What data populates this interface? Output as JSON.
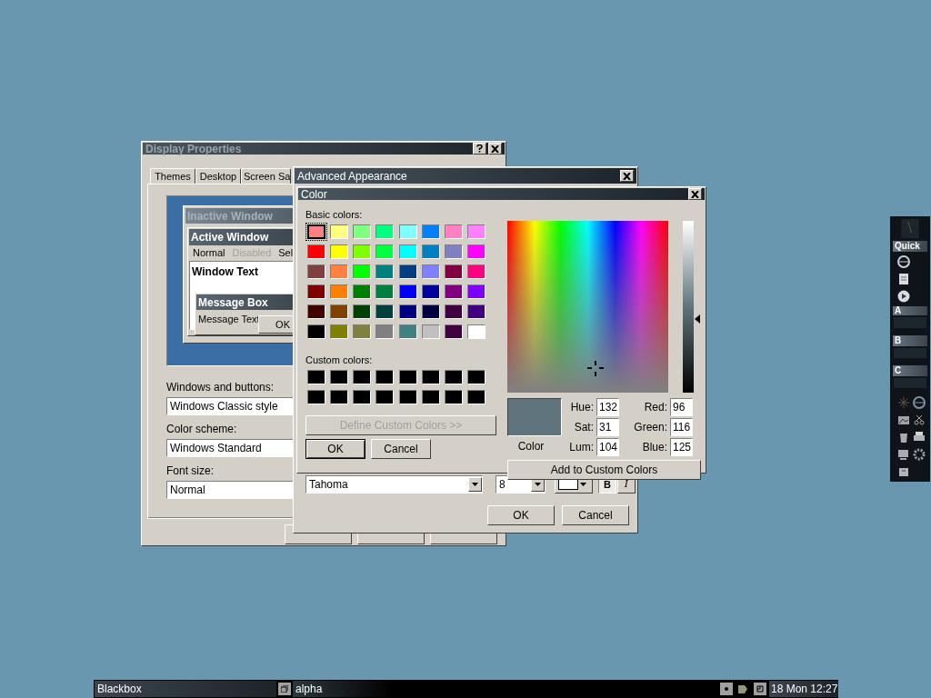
{
  "display_properties": {
    "title": "Display Properties",
    "tabs": [
      {
        "label": "Themes",
        "selected": false
      },
      {
        "label": "Desktop",
        "selected": false
      },
      {
        "label": "Screen Sa",
        "selected": false
      }
    ],
    "preview": {
      "inactive_title": "Inactive Window",
      "active_title": "Active Window",
      "menu": [
        {
          "label": "Normal",
          "disabled": false
        },
        {
          "label": "Disabled",
          "disabled": true
        },
        {
          "label": "Sel",
          "disabled": false
        }
      ],
      "window_text": "Window Text",
      "message_title": "Message Box",
      "message_text": "Message Text",
      "ok": "OK"
    },
    "settings": [
      {
        "label": "Windows and buttons:",
        "value": "Windows Classic style"
      },
      {
        "label": "Color scheme:",
        "value": "Windows Standard"
      },
      {
        "label": "Font size:",
        "value": "Normal"
      }
    ]
  },
  "advanced_appearance": {
    "title": "Advanced Appearance",
    "font": {
      "name": "Tahoma",
      "size": "8",
      "bold": true,
      "italic": false,
      "bold_label": "B",
      "italic_label": "I"
    },
    "buttons": [
      "OK",
      "Cancel"
    ]
  },
  "color_dialog": {
    "title": "Color",
    "basic_label": "Basic colors:",
    "basic_colors": [
      {
        "color": "#ff8080",
        "selected": true
      },
      {
        "color": "#ffff80",
        "selected": false
      },
      {
        "color": "#80ff80",
        "selected": false
      },
      {
        "color": "#00ff80",
        "selected": false
      },
      {
        "color": "#80ffff",
        "selected": false
      },
      {
        "color": "#0080ff",
        "selected": false
      },
      {
        "color": "#ff80c0",
        "selected": false
      },
      {
        "color": "#ff80ff",
        "selected": false
      },
      {
        "color": "#ff0000",
        "selected": false
      },
      {
        "color": "#ffff00",
        "selected": false
      },
      {
        "color": "#80ff00",
        "selected": false
      },
      {
        "color": "#00ff40",
        "selected": false
      },
      {
        "color": "#00ffff",
        "selected": false
      },
      {
        "color": "#0080c0",
        "selected": false
      },
      {
        "color": "#8080c0",
        "selected": false
      },
      {
        "color": "#ff00ff",
        "selected": false
      },
      {
        "color": "#804040",
        "selected": false
      },
      {
        "color": "#ff8040",
        "selected": false
      },
      {
        "color": "#00ff00",
        "selected": false
      },
      {
        "color": "#008080",
        "selected": false
      },
      {
        "color": "#004080",
        "selected": false
      },
      {
        "color": "#8080ff",
        "selected": false
      },
      {
        "color": "#800040",
        "selected": false
      },
      {
        "color": "#ff0080",
        "selected": false
      },
      {
        "color": "#800000",
        "selected": false
      },
      {
        "color": "#ff8000",
        "selected": false
      },
      {
        "color": "#008000",
        "selected": false
      },
      {
        "color": "#008040",
        "selected": false
      },
      {
        "color": "#0000ff",
        "selected": false
      },
      {
        "color": "#0000a0",
        "selected": false
      },
      {
        "color": "#800080",
        "selected": false
      },
      {
        "color": "#8000ff",
        "selected": false
      },
      {
        "color": "#400000",
        "selected": false
      },
      {
        "color": "#804000",
        "selected": false
      },
      {
        "color": "#004000",
        "selected": false
      },
      {
        "color": "#004040",
        "selected": false
      },
      {
        "color": "#000080",
        "selected": false
      },
      {
        "color": "#000040",
        "selected": false
      },
      {
        "color": "#400040",
        "selected": false
      },
      {
        "color": "#400080",
        "selected": false
      },
      {
        "color": "#000000",
        "selected": false
      },
      {
        "color": "#808000",
        "selected": false
      },
      {
        "color": "#808040",
        "selected": false
      },
      {
        "color": "#808080",
        "selected": false
      },
      {
        "color": "#408080",
        "selected": false
      },
      {
        "color": "#c0c0c0",
        "selected": false
      },
      {
        "color": "#400040",
        "selected": false
      },
      {
        "color": "#ffffff",
        "selected": false
      }
    ],
    "custom_label": "Custom colors:",
    "custom_colors": [
      {
        "color": "#000000"
      },
      {
        "color": "#000000"
      },
      {
        "color": "#000000"
      },
      {
        "color": "#000000"
      },
      {
        "color": "#000000"
      },
      {
        "color": "#000000"
      },
      {
        "color": "#000000"
      },
      {
        "color": "#000000"
      },
      {
        "color": "#000000"
      },
      {
        "color": "#000000"
      },
      {
        "color": "#000000"
      },
      {
        "color": "#000000"
      },
      {
        "color": "#000000"
      },
      {
        "color": "#000000"
      },
      {
        "color": "#000000"
      },
      {
        "color": "#000000"
      }
    ],
    "define_button": {
      "label": "Define Custom Colors >>",
      "disabled": true
    },
    "buttons": [
      {
        "label": "OK",
        "default": true
      },
      {
        "label": "Cancel",
        "default": false
      }
    ],
    "luminance": {
      "level": 0.43
    },
    "preview_label": "Color",
    "values": [
      {
        "label": "Hue:",
        "value": "132"
      },
      {
        "label": "Red:",
        "value": "96"
      },
      {
        "label": "Sat:",
        "value": "31"
      },
      {
        "label": "Green:",
        "value": "116"
      },
      {
        "label": "Lum:",
        "value": "104"
      },
      {
        "label": "Blue:",
        "value": "125"
      }
    ],
    "add_button": "Add to Custom Colors"
  },
  "dock": {
    "sections": [
      {
        "title": "Quick"
      },
      {
        "title": "A"
      },
      {
        "title": "B"
      },
      {
        "title": "C"
      }
    ]
  },
  "taskbar": {
    "workspace": "Blackbox",
    "window": "alpha",
    "clock": "18 Mon 12:27"
  }
}
